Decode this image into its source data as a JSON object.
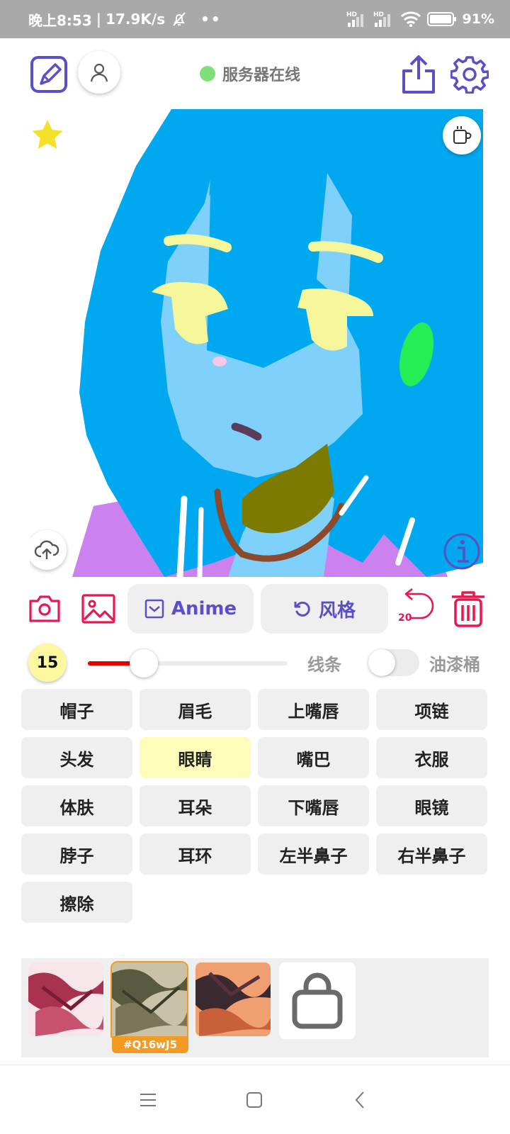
{
  "status_bar": {
    "time": "晚上8:53",
    "net_speed": "17.9K/s",
    "dots": "••",
    "signal1_label": "HD",
    "signal2_label": "HD",
    "battery": "91%"
  },
  "header": {
    "server_status": "服务器在线",
    "status_color": "#7fe07a"
  },
  "toolbar": {
    "model_label": "Anime",
    "style_label": "风格",
    "undo_count": "20"
  },
  "brush": {
    "size": "15",
    "size_fraction": 0.28,
    "line_label": "线条",
    "bucket_label": "油漆桶",
    "bucket_enabled": false
  },
  "parts": [
    {
      "label": "帽子",
      "selected": false
    },
    {
      "label": "眉毛",
      "selected": false
    },
    {
      "label": "上嘴唇",
      "selected": false
    },
    {
      "label": "项链",
      "selected": false
    },
    {
      "label": "头发",
      "selected": false
    },
    {
      "label": "眼睛",
      "selected": true
    },
    {
      "label": "嘴巴",
      "selected": false
    },
    {
      "label": "衣服",
      "selected": false
    },
    {
      "label": "体肤",
      "selected": false
    },
    {
      "label": "耳朵",
      "selected": false
    },
    {
      "label": "下嘴唇",
      "selected": false
    },
    {
      "label": "眼镜",
      "selected": false
    },
    {
      "label": "脖子",
      "selected": false
    },
    {
      "label": "耳环",
      "selected": false
    },
    {
      "label": "左半鼻子",
      "selected": false
    },
    {
      "label": "右半鼻子",
      "selected": false
    },
    {
      "label": "擦除",
      "selected": false
    }
  ],
  "styles": {
    "selected_code": "#Q16wJ5"
  },
  "colors": {
    "accent_purple": "#5b4fc5",
    "accent_red": "#e8174f",
    "selected_part": "#fdfcb8",
    "hair": "#00a8f0",
    "skin": "#7fd0fa",
    "eyes": "#f5f59a",
    "clothes": "#cc82ee"
  }
}
